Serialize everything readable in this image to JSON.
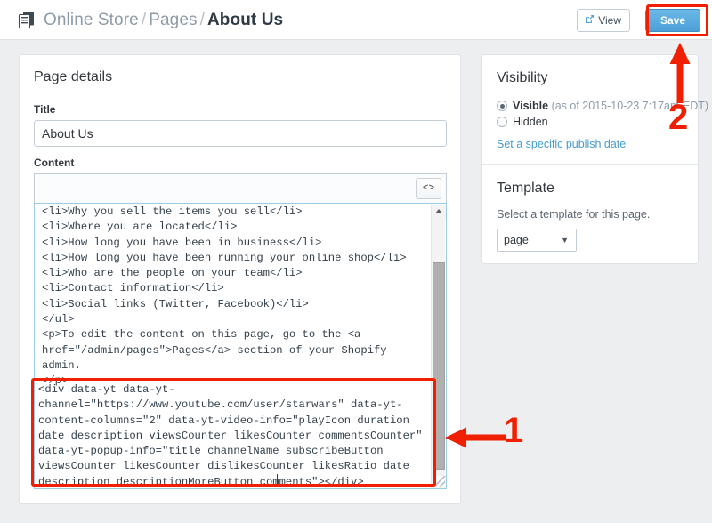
{
  "header": {
    "icon": "pages-stack-icon",
    "breadcrumb": {
      "root": "Online Store",
      "section": "Pages",
      "current": "About Us",
      "separator": "/"
    },
    "view_label": "View",
    "view_icon": "external-link-icon",
    "save_label": "Save",
    "save_color": "#4c9fd8"
  },
  "page_details": {
    "title": "Page details",
    "title_label": "Title",
    "title_value": "About Us",
    "content_label": "Content",
    "code_button_label": "<>",
    "code_button_icon": "code-brackets-icon",
    "editor_text_top": "<li>Why you sell the items you sell</li>\n<li>Where you are located</li>\n<li>How long you have been in business</li>\n<li>How long you have been running your online shop</li>\n<li>Who are the people on your team</li>\n<li>Contact information</li>\n<li>Social links (Twitter, Facebook)</li>\n</ul>\n<p>To edit the content on this page, go to the <a href=\"/admin/pages\">Pages</a> section of your Shopify admin.\n</p>\n",
    "editor_text_highlighted": "<div data-yt data-yt-channel=\"https://www.youtube.com/user/starwars\" data-yt-content-columns=\"2\" data-yt-video-info=\"playIcon duration date description viewsCounter likesCounter commentsCounter\" data-yt-popup-info=\"title channelName subscribeButton viewsCounter likesCounter dislikesCounter likesRatio date description descriptionMoreButton comments\"></div>",
    "scrollbar": {
      "up_icon": "scroll-up-arrow-icon",
      "down_icon": "scroll-down-arrow-icon"
    }
  },
  "visibility": {
    "title": "Visibility",
    "options": [
      {
        "label": "Visible",
        "note": "(as of 2015-10-23 7:17am EDT)",
        "selected": true
      },
      {
        "label": "Hidden",
        "note": "",
        "selected": false
      }
    ],
    "publish_link": "Set a specific publish date"
  },
  "template": {
    "title": "Template",
    "description": "Select a template for this page.",
    "selected_value": "page",
    "dropdown_icon": "chevron-down-icon"
  },
  "annotations": {
    "color": "#f01f00",
    "marker_1": "1",
    "marker_2": "2"
  }
}
